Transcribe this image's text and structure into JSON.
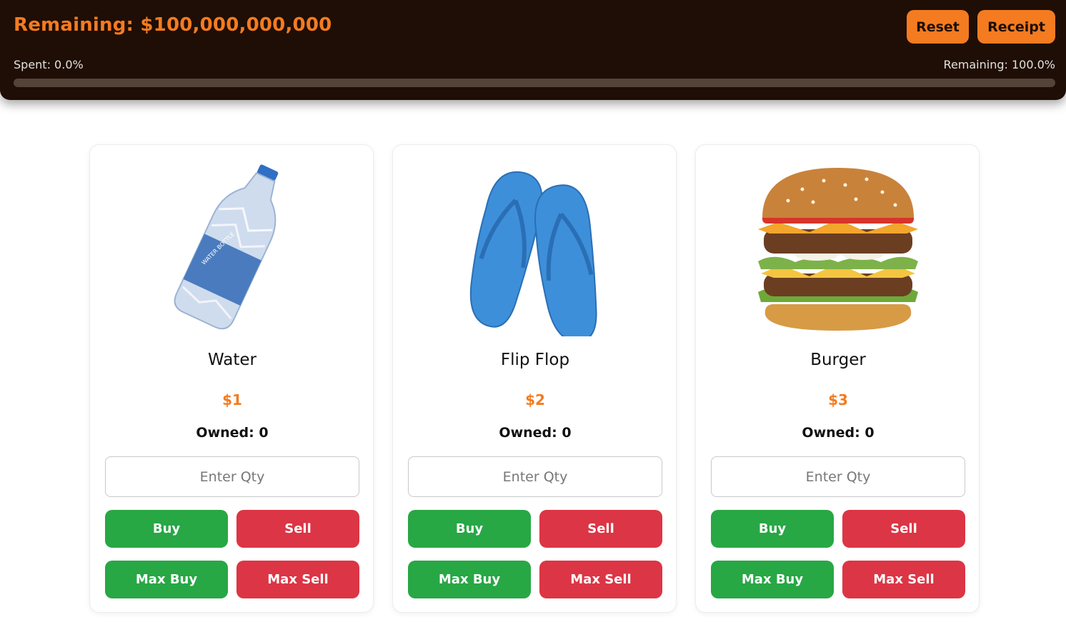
{
  "header": {
    "remaining": "Remaining: $100,000,000,000",
    "reset_label": "Reset",
    "receipt_label": "Receipt",
    "spent_label": "Spent: 0.0%",
    "remaining_pct_label": "Remaining: 100.0%",
    "spent_fraction": 0.0
  },
  "colors": {
    "accent": "#f47b20",
    "header_bg": "#1e0e05",
    "buy": "#28a745",
    "sell": "#dc3545"
  },
  "products": [
    {
      "name": "Water",
      "price": "$1",
      "owned": "Owned: 0",
      "qty_placeholder": "Enter Qty",
      "buy_label": "Buy",
      "sell_label": "Sell",
      "max_buy_label": "Max Buy",
      "max_sell_label": "Max Sell",
      "image_text": "WATER BOTTLE",
      "icon": "water-bottle-icon"
    },
    {
      "name": "Flip Flop",
      "price": "$2",
      "owned": "Owned: 0",
      "qty_placeholder": "Enter Qty",
      "buy_label": "Buy",
      "sell_label": "Sell",
      "max_buy_label": "Max Buy",
      "max_sell_label": "Max Sell",
      "icon": "flip-flop-icon"
    },
    {
      "name": "Burger",
      "price": "$3",
      "owned": "Owned: 0",
      "qty_placeholder": "Enter Qty",
      "buy_label": "Buy",
      "sell_label": "Sell",
      "max_buy_label": "Max Buy",
      "max_sell_label": "Max Sell",
      "icon": "burger-icon"
    }
  ]
}
